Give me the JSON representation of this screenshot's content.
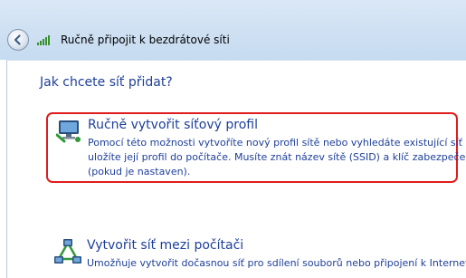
{
  "window": {
    "title": "Ručně připojit k bezdrátové síti",
    "back_icon": "back-arrow-icon",
    "title_icon": "wireless-signal-icon"
  },
  "main": {
    "heading": "Jak chcete síť přidat?",
    "options": [
      {
        "icon": "network-profile-icon",
        "title": "Ručně vytvořit síťový profil",
        "description_lines": [
          "Pomocí této možnosti vytvoříte nový profil sítě nebo vyhledáte existující síť a",
          "uložíte její profil do počítače. Musíte znát název sítě (SSID) a klíč zabezpečení",
          "(pokud je nastaven)."
        ],
        "highlighted": true
      },
      {
        "icon": "adhoc-network-icon",
        "title": "Vytvořit síť mezi počítači",
        "description_lines": [
          "Umožňuje vytvořit dočasnou síť pro sdílení souborů nebo připojení k Internetu."
        ],
        "highlighted": false
      }
    ]
  },
  "colors": {
    "link_blue": "#1e3f9a",
    "highlight_red": "#e01c1c",
    "titlebar": "#d0e1f3"
  }
}
